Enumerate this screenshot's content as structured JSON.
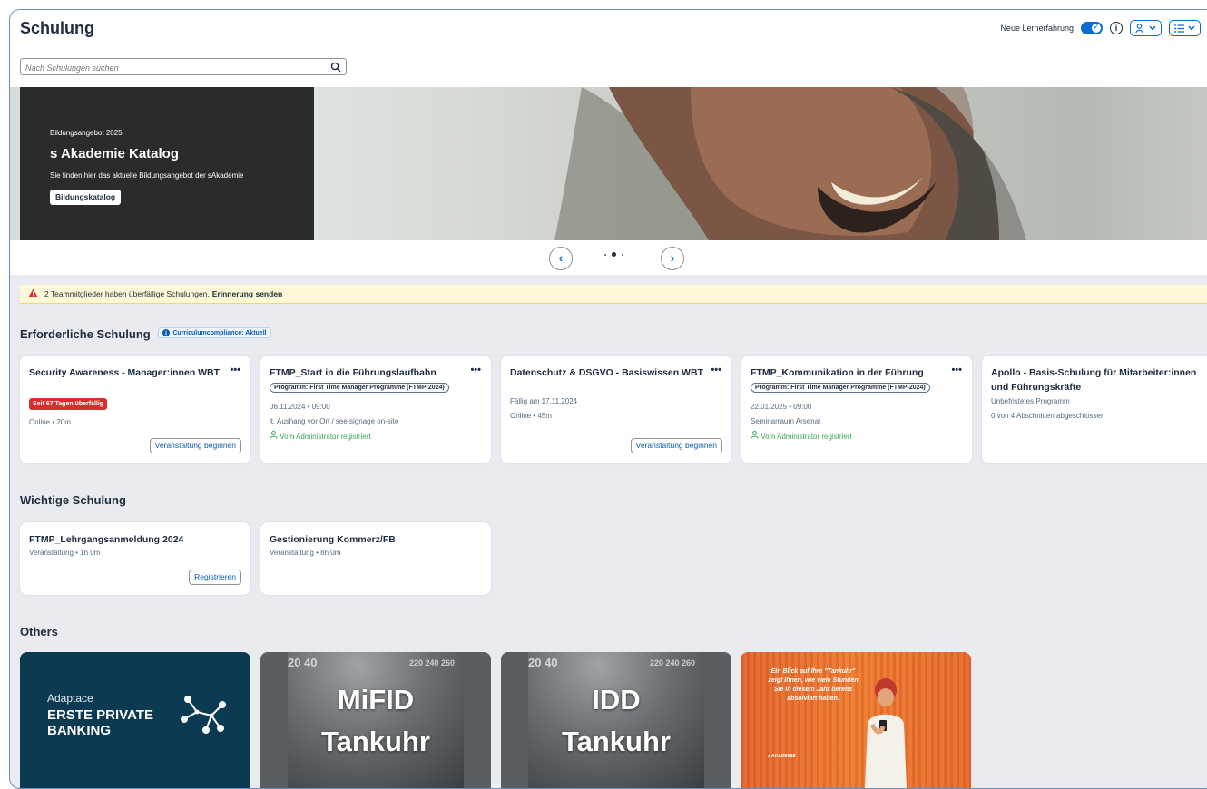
{
  "header": {
    "title": "Schulung",
    "search_placeholder": "Nach Schulungen suchen",
    "new_experience_label": "Neue Lernerfahrung"
  },
  "hero": {
    "kicker": "Bildungsangebot 2025",
    "title": "s Akademie Katalog",
    "description": "Sie finden hier das aktuelle Bildungsangebot der sAkademie",
    "button_label": "Bildungskatalog",
    "prev_glyph": "‹",
    "next_glyph": "›",
    "slide_count": 3,
    "active_slide": 2
  },
  "alert": {
    "text": "2 Teammitglieder haben überfällige Schulungen.",
    "action": "Erinnerung senden",
    "close_glyph": "×"
  },
  "required": {
    "title": "Erforderliche Schulung",
    "badge": "Curriculumcompliance: Aktuell",
    "cards": [
      {
        "title": "Security Awareness - Manager:innen WBT",
        "overdue": "Seit 67 Tagen überfällig",
        "meta": "Online • 20m",
        "button": "Veranstaltung beginnen"
      },
      {
        "title": "FTMP_Start in die Führungslaufbahn",
        "program": "Programm: First Time Manager Programme (FTMP-2024)",
        "date": "06.11.2024 • 09:00",
        "location": "lt. Aushang vor Ort / see signage on-site",
        "registered": "Vom Administrator registriert"
      },
      {
        "title": "Datenschutz & DSGVO - Basiswissen WBT",
        "due": "Fällig am 17.11.2024",
        "meta": "Online • 45m",
        "button": "Veranstaltung beginnen"
      },
      {
        "title": "FTMP_Kommunikation in der Führung",
        "program": "Programm: First Time Manager Programme (FTMP-2024)",
        "date": "22.01.2025 • 09:00",
        "location": "Seminarraum Arsenal",
        "registered": "Vom Administrator registriert"
      },
      {
        "title": "Apollo - Basis-Schulung für Mitarbeiter:innen und Führungskräfte",
        "type": "Unbefristetes Programm",
        "progress": "0 von 4 Abschnitten abgeschlossen"
      }
    ]
  },
  "important": {
    "title": "Wichtige Schulung",
    "cards": [
      {
        "title": "FTMP_Lehrgangsanmeldung 2024",
        "meta": "Veranstaltung • 1h 0m",
        "button": "Registrieren"
      },
      {
        "title": "Gestionierung Kommerz/FB",
        "meta": "Veranstaltung • 8h 0m"
      }
    ]
  },
  "others": {
    "title": "Others",
    "tiles": [
      {
        "small": "Adaptace",
        "big": "ERSTE PRIVATE BANKING"
      },
      {
        "line1": "MiFID",
        "line2": "Tankuhr",
        "ticks": "20 40",
        "ticks_right": "220 240 260"
      },
      {
        "line1": "IDD",
        "line2": "Tankuhr",
        "ticks": "20 40",
        "ticks_right": "220 240 260"
      },
      {
        "text": "Ein Blick auf Ihre \"Tankuhr\" zeigt Ihnen, wie viele Stunden Sie in diesem Jahr bereits absolviert haben.",
        "brand": "s AKADEMIE"
      }
    ]
  },
  "colors": {
    "accent": "#0a6ed1",
    "alert_bg": "#fff8d6",
    "overdue": "#d92e2e",
    "registered": "#3aa85a",
    "page_bg": "#e9ebf1"
  }
}
